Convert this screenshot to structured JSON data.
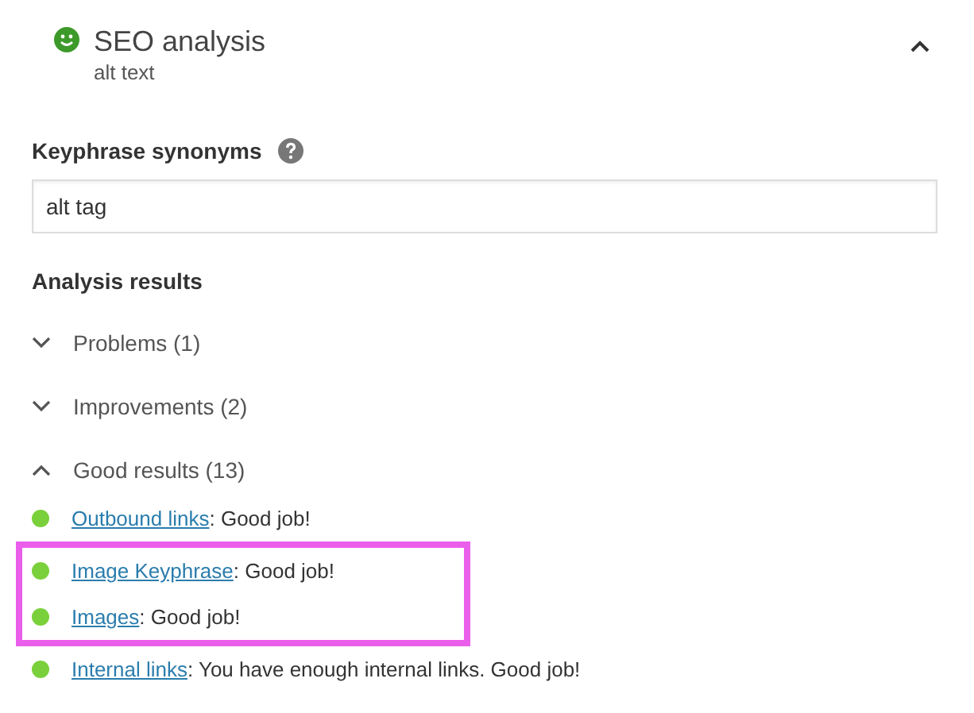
{
  "panel": {
    "title": "SEO analysis",
    "subtitle": "alt text",
    "expanded": true
  },
  "synonyms": {
    "label": "Keyphrase synonyms",
    "value": "alt tag"
  },
  "analysis": {
    "heading": "Analysis results",
    "groups": [
      {
        "label": "Problems (1)",
        "expanded": false
      },
      {
        "label": "Improvements (2)",
        "expanded": false
      },
      {
        "label": "Good results (13)",
        "expanded": true
      }
    ],
    "results": [
      {
        "link": "Outbound links",
        "text": ": Good job!",
        "color": "#7ad03a",
        "highlighted": false
      },
      {
        "link": "Image Keyphrase",
        "text": ": Good job!",
        "color": "#7ad03a",
        "highlighted": true
      },
      {
        "link": "Images",
        "text": ": Good job!",
        "color": "#7ad03a",
        "highlighted": true
      },
      {
        "link": "Internal links",
        "text": ": You have enough internal links. Good job!",
        "color": "#7ad03a",
        "highlighted": false
      }
    ]
  }
}
